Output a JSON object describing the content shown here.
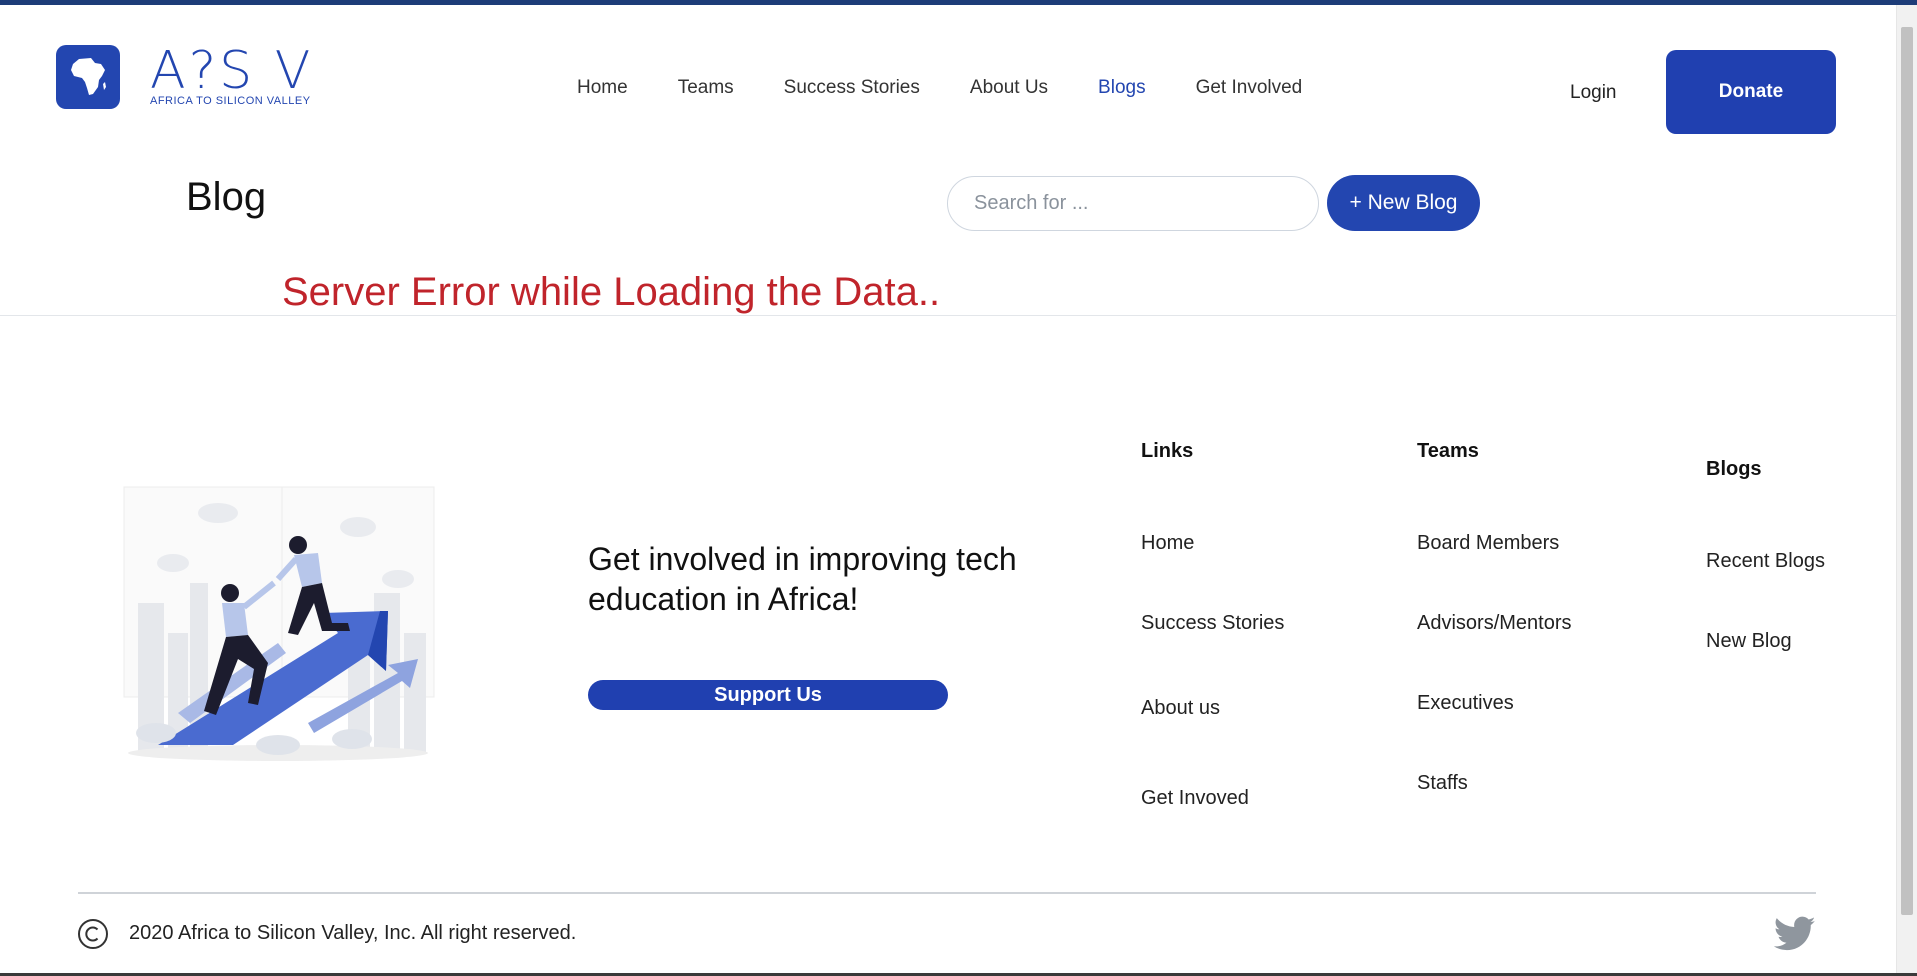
{
  "header": {
    "logo_word": "A?S V",
    "logo_tagline": "AFRICA TO SILICON VALLEY",
    "nav": [
      {
        "label": "Home",
        "active": false
      },
      {
        "label": "Teams",
        "active": false
      },
      {
        "label": "Success Stories",
        "active": false
      },
      {
        "label": "About Us",
        "active": false
      },
      {
        "label": "Blogs",
        "active": true
      },
      {
        "label": "Get Involved",
        "active": false
      }
    ],
    "login_label": "Login",
    "donate_label": "Donate"
  },
  "blog_bar": {
    "title": "Blog",
    "search_placeholder": "Search for ...",
    "new_blog_label": "+ New Blog"
  },
  "main": {
    "error_message": "Server Error while Loading the Data.."
  },
  "footer": {
    "cta_heading": "Get involved in improving tech education in Africa!",
    "support_label": "Support Us",
    "columns": {
      "links": {
        "heading": "Links",
        "items": [
          "Home",
          "Success Stories",
          "About us",
          "Get Invoved"
        ]
      },
      "teams": {
        "heading": "Teams",
        "items": [
          "Board Members",
          "Advisors/Mentors",
          "Executives",
          "Staffs"
        ]
      },
      "blogs": {
        "heading": "Blogs",
        "items": [
          "Recent Blogs",
          "New Blog"
        ]
      }
    },
    "copyright": "2020 Africa to Silicon Valley, Inc. All right reserved."
  },
  "colors": {
    "brand_blue": "#2346b0",
    "error_red": "#c0242b",
    "top_border": "#1d3c78"
  },
  "icons": {
    "logo": "africa-map-icon",
    "copyright": "copyright-icon",
    "social": "twitter-icon"
  }
}
